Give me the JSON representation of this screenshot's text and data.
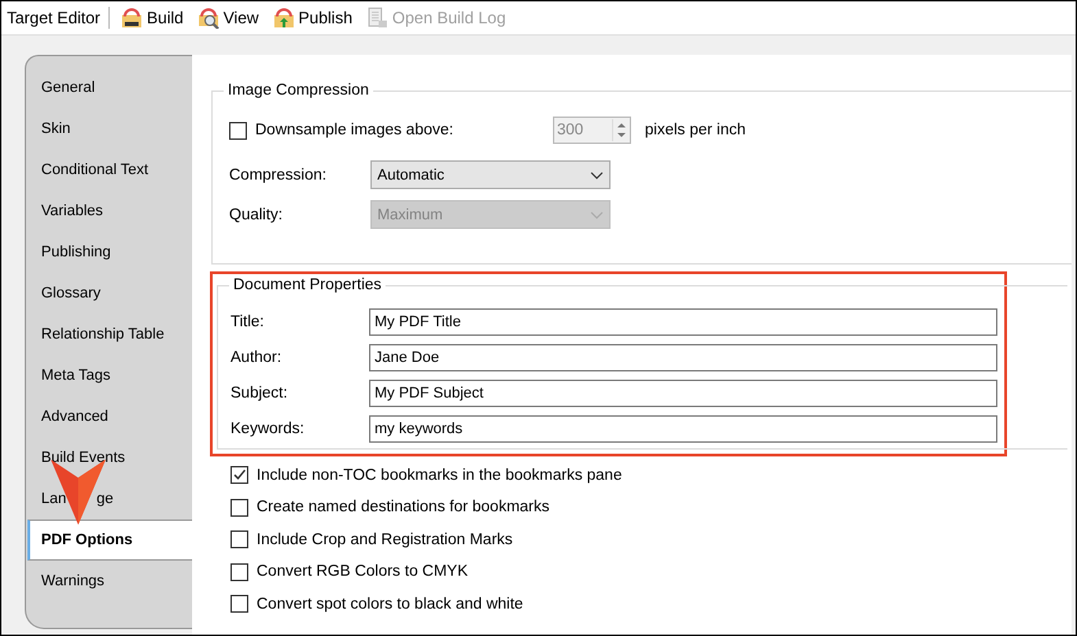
{
  "toolbar": {
    "title": "Target Editor",
    "buttons": [
      {
        "label": "Build",
        "disabled": false,
        "kind": "build"
      },
      {
        "label": "View",
        "disabled": false,
        "kind": "view"
      },
      {
        "label": "Publish",
        "disabled": false,
        "kind": "publish"
      },
      {
        "label": "Open Build Log",
        "disabled": true,
        "kind": "log"
      }
    ]
  },
  "tabs": [
    {
      "label": "General",
      "selected": false
    },
    {
      "label": "Skin",
      "selected": false
    },
    {
      "label": "Conditional Text",
      "selected": false
    },
    {
      "label": "Variables",
      "selected": false
    },
    {
      "label": "Publishing",
      "selected": false
    },
    {
      "label": "Glossary",
      "selected": false
    },
    {
      "label": "Relationship Table",
      "selected": false
    },
    {
      "label": "Meta Tags",
      "selected": false
    },
    {
      "label": "Advanced",
      "selected": false
    },
    {
      "label": "Build Events",
      "selected": false
    },
    {
      "label_parts": [
        "Lan",
        "ge"
      ],
      "selected": false
    },
    {
      "label": "PDF Options",
      "selected": true
    },
    {
      "label": "Warnings",
      "selected": false
    }
  ],
  "image_compression": {
    "title": "Image Compression",
    "downsample": {
      "label": "Downsample images above:",
      "checked": false,
      "value": "300",
      "unit": "pixels per inch"
    },
    "selects": [
      {
        "label": "Compression:",
        "value": "Automatic",
        "disabled": false
      },
      {
        "label": "Quality:",
        "value": "Maximum",
        "disabled": true
      }
    ]
  },
  "document_properties": {
    "title": "Document Properties",
    "fields": [
      {
        "label": "Title:",
        "value": "My PDF Title"
      },
      {
        "label": "Author:",
        "value": "Jane Doe"
      },
      {
        "label": "Subject:",
        "value": "My PDF Subject"
      },
      {
        "label": "Keywords:",
        "value": "my keywords"
      }
    ]
  },
  "options": [
    {
      "label": "Include non-TOC bookmarks in the bookmarks pane",
      "checked": true
    },
    {
      "label": "Create named destinations for bookmarks",
      "checked": false
    },
    {
      "label": "Include Crop and Registration Marks",
      "checked": false
    },
    {
      "label": "Convert RGB Colors to CMYK",
      "checked": false
    },
    {
      "label": "Convert spot colors to black and white",
      "checked": false
    }
  ]
}
